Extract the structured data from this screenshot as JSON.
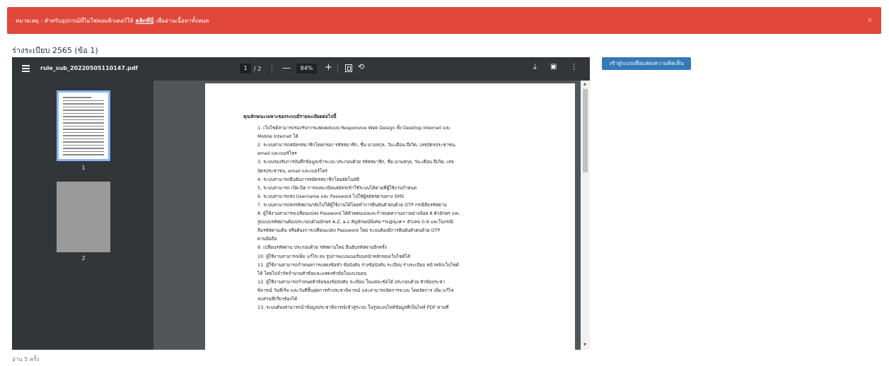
{
  "alert": {
    "prefix": "หมายเหตุ : สำหรับอุปกรณ์ที่ไม่ใช่คอมพิวเตอร์ให้",
    "link": "คลิกที่นี่",
    "suffix": "เพื่ออ่านเนื้อหาทั้งหมด",
    "close": "×"
  },
  "doc_title": "ร่างระเบียบ 2565 (ข้อ 1)",
  "viewer": {
    "filename": "rule_sub_20220505110147.pdf",
    "current_page": "1",
    "total_pages": "/ 2",
    "zoom": "84%",
    "zoom_out": "—",
    "zoom_in": "+",
    "rotate": "⟲",
    "download": "⤓",
    "print": "▣",
    "more": "⋮",
    "thumbnails": [
      {
        "label": "1"
      },
      {
        "label": "2"
      }
    ],
    "page_heading": "คุณลักษณะเฉพาะของระบบมีรายละเอียดต่อไปนี้",
    "page_lines": [
      "1. เว็บไซต์สามารถรองรับการแสดงผลแบบ Responsive Web Design ทั้ง Desktop Internet และ",
      "Mobile Internet ได้",
      "2. ระบบสามารถสมัครสมาชิกโดยกรอก รหัสสมาชิก, ชื่อ-นามสกุล, วัน-เดือน-ปีเกิด, เลขบัตรประชาชน,",
      "email และเบอร์โทร",
      "3. ระบบรองรับการบันทึกข้อมูลเข้าระบบ ประกอบด้วย รหัสสมาชิก, ชื่อ-นามสกุล, วัน-เดือน-ปีเกิด, เลข",
      "บัตรประชาชน, email และเบอร์โทร",
      "4. ระบบสามารถยืนยันการสมัครสมาชิกโดยอัตโนมัติ",
      "5. ระบบสามารถ เปิด-ปิด การลงทะเบียนสมัครเข้าใช้ระบบได้ตามที่ผู้ใช้งานกำหนด",
      "6. ระบบสามารถส่ง Username และ Password ไปให้ผู้สมัครผ่านทาง SMS",
      "7. ระบบสามารถส่งรหัสผ่านกลับไปให้ผู้ใช้งานได้โดยทำการยืนยันตัวตนด้วย OTP กรณีลืมรหัสผ่าน",
      "8. ผู้ใช้งานสามารถเปลี่ยนแปลง Password ได้ด้วยตนเองและกำหนดความยาวอย่างน้อย 8 ตัวอักษร และ",
      "รูปแบบรหัสผ่านต้องประกอบด้วยอักษร A-Z, a-z สัญลักษณ์พิเศษ *%@&/#+ ตัวเลข 0-9 และในกรณี",
      "ลืมรหัสผ่านเดิม หรือต้องการเปลี่ยนแปลง Password ใหม่ ระบบต้องมีการยืนยันตัวตนด้วย OTP",
      "ผ่านมือถือ",
      "9. เปลี่ยนรหัสผ่าน ประกอบด้วย รหัสผ่านใหม่ ยืนยันรหัสผ่านอีกครั้ง",
      "10. ผู้ใช้งานสามารถเพิ่ม แก้ไข ลบ รูปภาพแบนเนอร์บนหน้าหลักของเว็บไซต์ได้",
      "11. ผู้ใช้งานสามารถกำหนดการแสดงข้อหัว ข้อบังคับ ร่างข้อบังคับ ระเบียบ ร่างระเบียบ หน้าหลักเว็บไซต์",
      "ได้ โดยไม่จำกัดจำนวนหัวข้อและแสดงหัวข้อในแนวนอน",
      "12. ผู้ใช้งานสามารถกำหนดหัวข้อของข้อบังคับ ระเบียบ ในแต่ละข้อได้ ประกอบด้วย หัวข้อประชา",
      "พิจารณ์ วันที่เริ่ม และวันที่สิ้นสุดการทำประชาพิจารณ์ และสามารถจัดการระบบ โดยจัดการ เพิ่ม แก้ไข",
      "ลบส่วนที่เกี่ยวข้องได้",
      "13. ระบบต้องสามารถนำข้อมูลประชาพิจารณ์เข้าสู่ระบบ ในรูปแบบไฟล์ข้อมูลที่เป็นไฟล์ PDF ตามที่"
    ]
  },
  "comment_button": "เข้าสู่ระบบเพื่อแสดงความคิดเห็น",
  "reads": "อ่าน 5 ครั้ง"
}
